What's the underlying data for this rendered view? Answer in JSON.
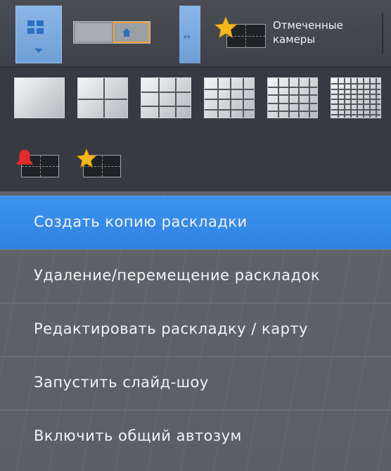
{
  "toolbar": {
    "layout_grid_button_icon": "grid-2x2-icon",
    "layout_thumbnail_icon": "home-icon",
    "split_button_icon": "split-arrows-icon",
    "marked_cameras": {
      "line1": "Отмеченные",
      "line2": "камеры",
      "icon": "star-icon"
    }
  },
  "palette": {
    "layouts": [
      {
        "name": "1x1",
        "cols": 1,
        "rows": 1
      },
      {
        "name": "2x2",
        "cols": 2,
        "rows": 2
      },
      {
        "name": "3x3",
        "cols": 3,
        "rows": 3
      },
      {
        "name": "4x4",
        "cols": 4,
        "rows": 4
      },
      {
        "name": "5x5",
        "cols": 5,
        "rows": 5
      },
      {
        "name": "8x8",
        "cols": 8,
        "rows": 8
      }
    ],
    "special": [
      {
        "name": "alarm-cameras",
        "icon": "bell-icon",
        "color": "#e62a2a"
      },
      {
        "name": "marked-cameras",
        "icon": "star-icon",
        "color": "#f5b81c"
      }
    ]
  },
  "colors": {
    "accent_blue": "#3a8ef0",
    "star_yellow": "#f5b81c",
    "bell_red": "#e62a2a",
    "selection_orange": "#f0a030"
  },
  "menu": {
    "items": [
      {
        "label": "Создать копию раскладки",
        "active": true
      },
      {
        "label": "Удаление/перемещение раскладок",
        "active": false
      },
      {
        "label": "Редактировать раскладку / карту",
        "active": false
      },
      {
        "label": "Запустить слайд-шоу",
        "active": false
      },
      {
        "label": "Включить общий автозум",
        "active": false
      }
    ]
  }
}
